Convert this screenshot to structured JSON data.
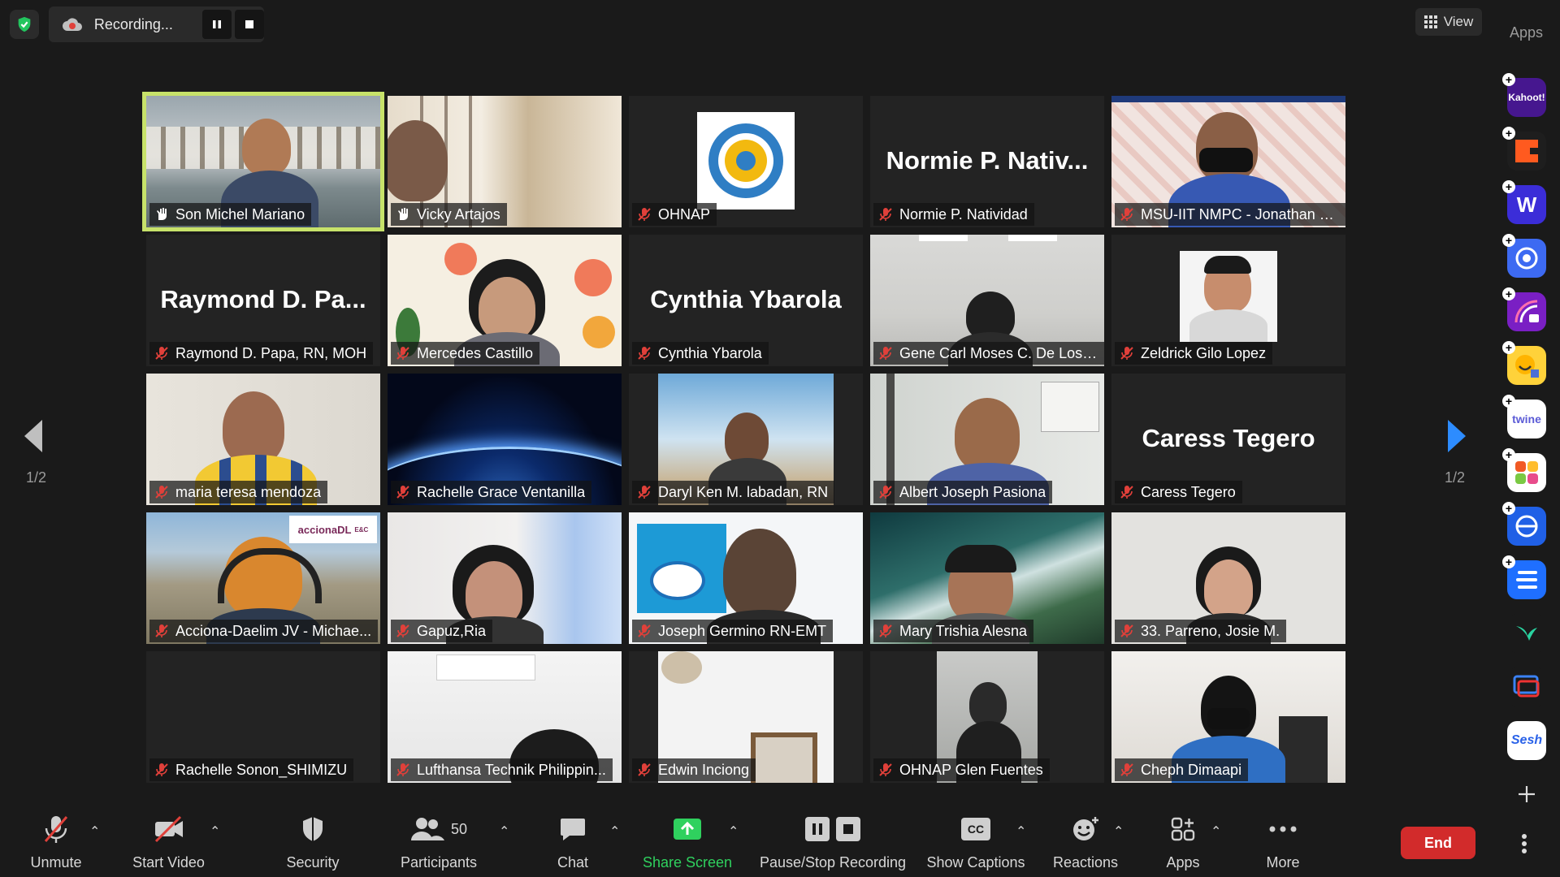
{
  "top": {
    "recording_text": "Recording...",
    "view_label": "View",
    "apps_label": "Apps"
  },
  "pagination": {
    "left": "1/2",
    "right": "1/2"
  },
  "tiles": [
    {
      "name": "Son Michel Mariano",
      "big": "",
      "mic": "hand"
    },
    {
      "name": "Vicky Artajos",
      "big": "",
      "mic": "hand"
    },
    {
      "name": "OHNAP",
      "big": "",
      "mic": "muted"
    },
    {
      "name": "Normie P. Natividad",
      "big": "Normie P. Nativ...",
      "mic": "muted"
    },
    {
      "name": "MSU-IIT NMPC - Jonathan P...",
      "big": "",
      "mic": "muted"
    },
    {
      "name": "Raymond D. Papa, RN, MOH",
      "big": "Raymond D. Pa...",
      "mic": "muted"
    },
    {
      "name": "Mercedes Castillo",
      "big": "",
      "mic": "muted"
    },
    {
      "name": "Cynthia Ybarola",
      "big": "Cynthia Ybarola",
      "mic": "muted"
    },
    {
      "name": "Gene Carl Moses C. De Los S...",
      "big": "",
      "mic": "muted"
    },
    {
      "name": "Zeldrick Gilo Lopez",
      "big": "",
      "mic": "muted"
    },
    {
      "name": "maria teresa mendoza",
      "big": "",
      "mic": "muted"
    },
    {
      "name": "Rachelle Grace Ventanilla",
      "big": "",
      "mic": "muted"
    },
    {
      "name": "Daryl Ken M. labadan, RN",
      "big": "",
      "mic": "muted"
    },
    {
      "name": "Albert Joseph Pasiona",
      "big": "",
      "mic": "muted"
    },
    {
      "name": "Caress Tegero",
      "big": "Caress Tegero",
      "mic": "muted"
    },
    {
      "name": "Acciona-Daelim JV - Michae...",
      "big": "",
      "mic": "muted"
    },
    {
      "name": "Gapuz,Ria",
      "big": "",
      "mic": "muted"
    },
    {
      "name": "Joseph Germino RN-EMT",
      "big": "",
      "mic": "muted"
    },
    {
      "name": "Mary Trishia Alesna",
      "big": "",
      "mic": "muted"
    },
    {
      "name": "33. Parreno, Josie M.",
      "big": "",
      "mic": "muted"
    },
    {
      "name": "Rachelle Sonon_SHIMIZU",
      "big": "",
      "mic": "muted"
    },
    {
      "name": "Lufthansa Technik Philippin...",
      "big": "",
      "mic": "muted"
    },
    {
      "name": "Edwin Inciong",
      "big": "",
      "mic": "muted"
    },
    {
      "name": "OHNAP Glen Fuentes",
      "big": "",
      "mic": "muted"
    },
    {
      "name": "Cheph Dimaapi",
      "big": "",
      "mic": "muted"
    }
  ],
  "tile_text": {
    "accionadl": "accionaDL",
    "ebc": "E&C"
  },
  "apps": [
    {
      "name": "Kahoot!",
      "short": "Kahoot!",
      "bg": "#46178f",
      "fg": "#ffffff"
    },
    {
      "name": "Orange app",
      "short": "",
      "bg": "#1e1e1e",
      "fg": "#ff5a1f"
    },
    {
      "name": "Wordwall",
      "short": "W",
      "bg": "#3b2dd8",
      "fg": "#ffffff"
    },
    {
      "name": "Circle app",
      "short": "",
      "bg": "#3d6af2",
      "fg": "#ffffff"
    },
    {
      "name": "Purple app",
      "short": "",
      "bg": "#7a1fc4",
      "fg": "#ffffff"
    },
    {
      "name": "Emoji app",
      "short": "",
      "bg": "#ffd23a",
      "fg": "#333333"
    },
    {
      "name": "twine",
      "short": "twine",
      "bg": "#ffffff",
      "fg": "#5b5bd6"
    },
    {
      "name": "Blocks app",
      "short": "",
      "bg": "#ffffff",
      "fg": "#333333"
    },
    {
      "name": "Sync app",
      "short": "",
      "bg": "#2060e6",
      "fg": "#ffffff"
    },
    {
      "name": "Stack app",
      "short": "",
      "bg": "#1f6fff",
      "fg": "#ffffff"
    },
    {
      "name": "Bird app",
      "short": "",
      "bg": "#1a1a1a",
      "fg": "#29d3a0"
    },
    {
      "name": "Screen app",
      "short": "",
      "bg": "#1a1a1a",
      "fg": "#e33"
    },
    {
      "name": "Sesh",
      "short": "Sesh",
      "bg": "#ffffff",
      "fg": "#2a62e8"
    }
  ],
  "toolbar": {
    "unmute": "Unmute",
    "start_video": "Start Video",
    "security": "Security",
    "participants": "Participants",
    "participants_count": "50",
    "chat": "Chat",
    "share_screen": "Share Screen",
    "pause_stop": "Pause/Stop Recording",
    "captions": "Show Captions",
    "captions_icon": "CC",
    "reactions": "Reactions",
    "apps": "Apps",
    "more": "More",
    "end": "End"
  },
  "colors": {
    "active_speaker": "#c7e26a",
    "share_green": "#2fd15e",
    "end_red": "#d22b2b",
    "muted_red": "#e0403a"
  }
}
